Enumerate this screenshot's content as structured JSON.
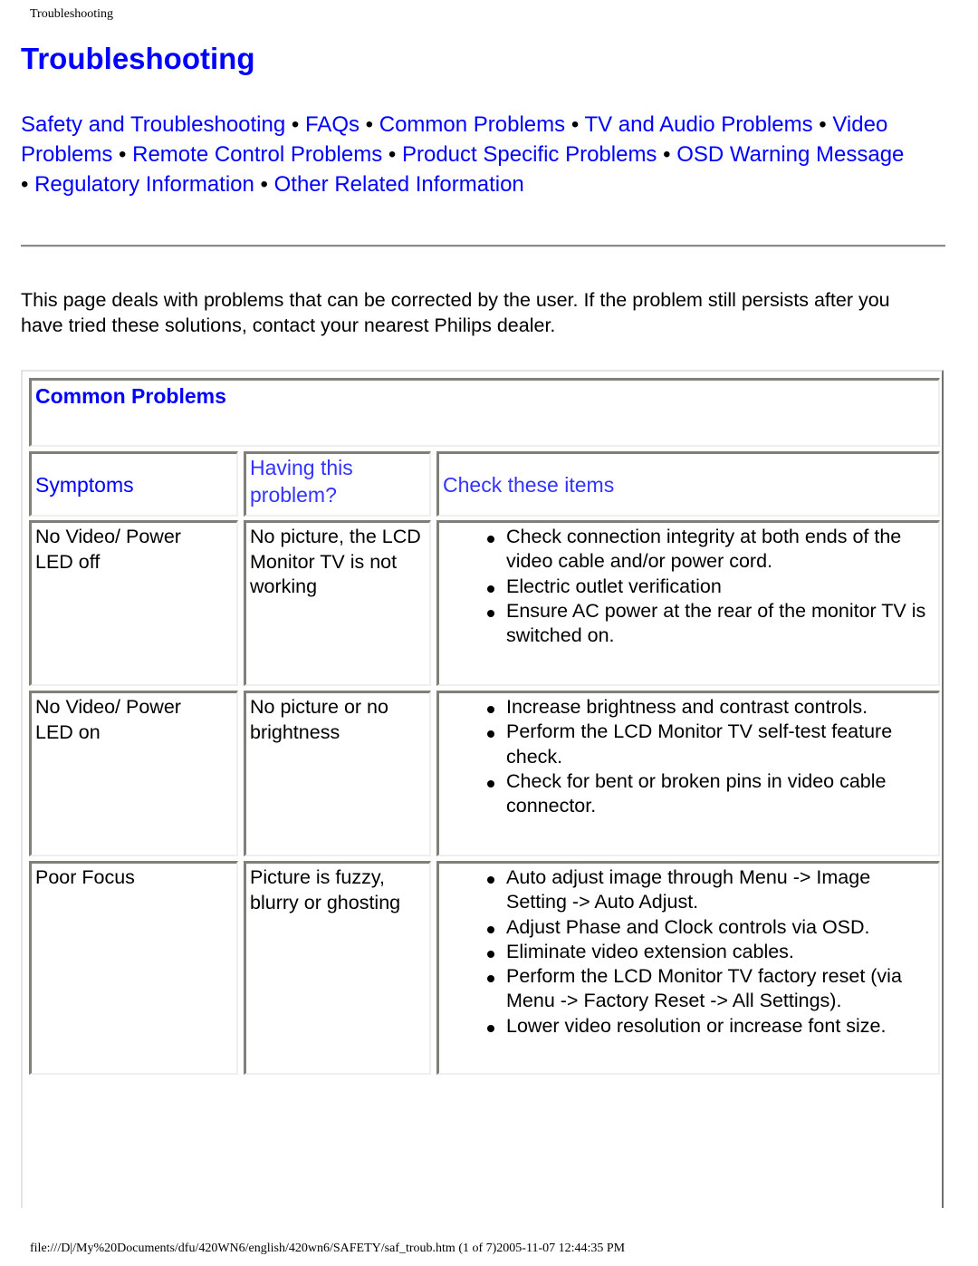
{
  "page_header": "Troubleshooting",
  "title": "Troubleshooting",
  "nav": {
    "separator": "•",
    "links": [
      "Safety and Troubleshooting",
      "FAQs",
      "Common Problems",
      "TV and Audio Problems",
      "Video Problems",
      "Remote Control Problems",
      "Product Specific Problems",
      "OSD Warning Message",
      "Regulatory Information",
      "Other Related Information"
    ]
  },
  "intro": "This page deals with problems that can be corrected by the user. If the problem still persists after you have tried these solutions, contact your nearest Philips dealer.",
  "table": {
    "section_title": "Common Problems",
    "headers": {
      "symptoms": "Symptoms",
      "having": "Having this problem?",
      "check": "Check these items"
    },
    "rows": [
      {
        "symptom": "No Video/ Power LED off",
        "problem": "No picture, the LCD Monitor TV is not working",
        "items": [
          "Check connection integrity at both ends of the video cable and/or power cord.",
          "Electric outlet verification",
          "Ensure AC power at the rear of the monitor TV is switched on."
        ]
      },
      {
        "symptom": "No Video/ Power LED on",
        "problem": "No picture or no brightness",
        "items": [
          "Increase brightness and contrast controls.",
          "Perform the LCD Monitor TV self-test feature check.",
          "Check for bent or broken pins in video cable connector."
        ]
      },
      {
        "symptom": "Poor Focus",
        "problem": "Picture is fuzzy, blurry or ghosting",
        "items": [
          "Auto adjust image through Menu -> Image Setting -> Auto Adjust.",
          "Adjust Phase and Clock controls via OSD.",
          "Eliminate video extension cables.",
          "Perform the LCD Monitor TV factory reset (via Menu -> Factory Reset -> All Settings).",
          "Lower video resolution or increase font size."
        ]
      }
    ]
  },
  "footer": "file:///D|/My%20Documents/dfu/420WN6/english/420wn6/SAFETY/saf_troub.htm (1 of 7)2005-11-07 12:44:35 PM",
  "colors": {
    "link": "#0000ff",
    "header_light": "#3333ff",
    "cell_border": "#808078"
  }
}
